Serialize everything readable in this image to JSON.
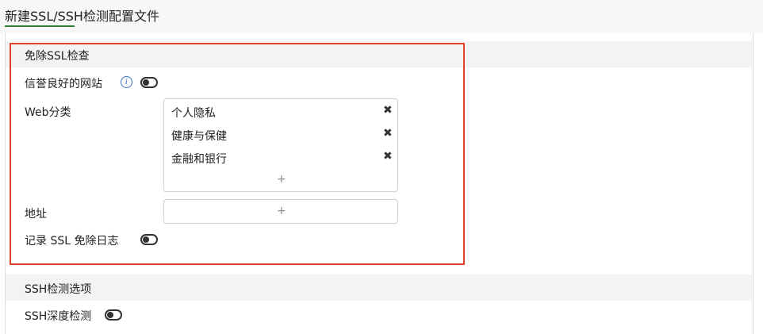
{
  "header": {
    "title": "新建SSL/SSH检测配置文件"
  },
  "ssl_exempt": {
    "title": "免除SSL检查",
    "reputable_sites_label": "信誉良好的网站",
    "reputable_sites_enabled": false,
    "web_category_label": "Web分类",
    "web_categories": [
      {
        "label": "个人隐私",
        "remove_icon": "✖"
      },
      {
        "label": "健康与保健",
        "remove_icon": "✖"
      },
      {
        "label": "金融和银行",
        "remove_icon": "✖"
      }
    ],
    "add_symbol": "+",
    "address_label": "地址",
    "log_label": "记录 SSL 免除日志",
    "log_enabled": false
  },
  "ssh": {
    "title": "SSH检测选项",
    "deep_inspection_label": "SSH深度检测",
    "deep_inspection_enabled": false
  },
  "colors": {
    "highlight_border": "#e0442f",
    "title_underline": "#2e7d32",
    "info_icon": "#3a72c4"
  }
}
